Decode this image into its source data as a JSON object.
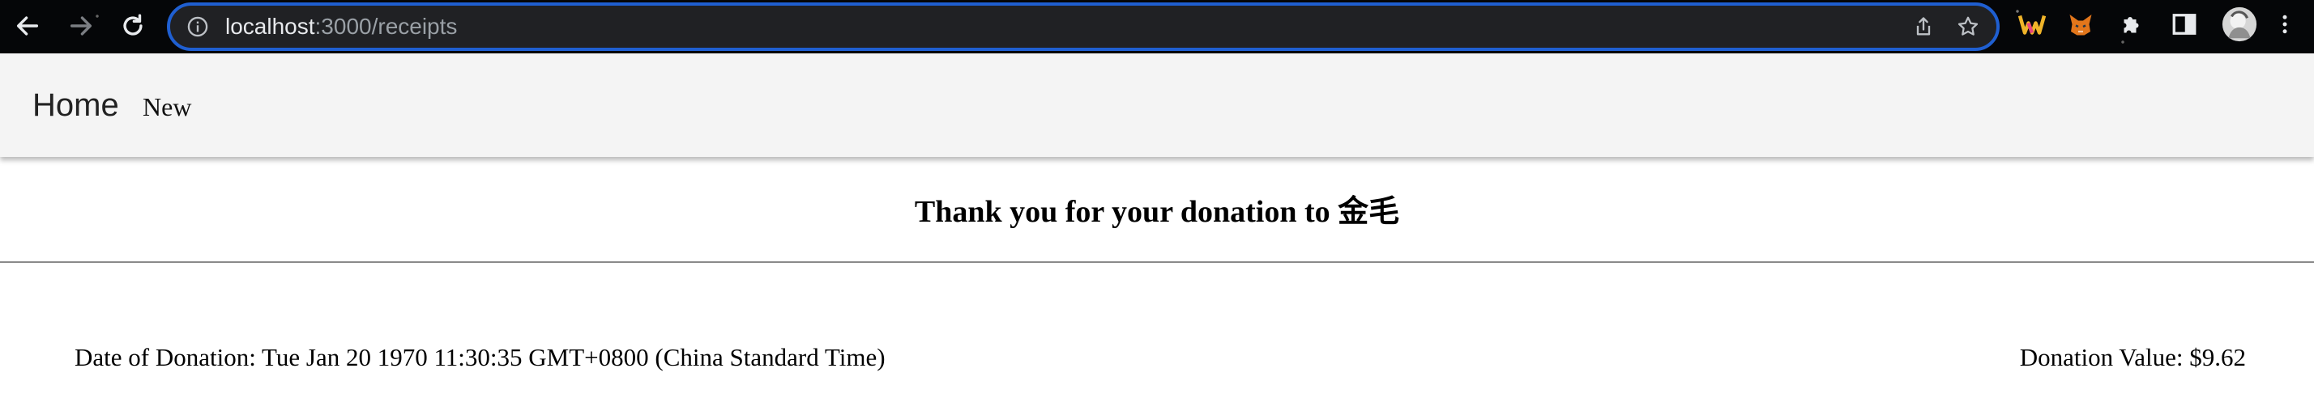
{
  "browser": {
    "url_host": "localhost",
    "url_path": ":3000/receipts",
    "accent_color": "#1f5fd1",
    "icons": [
      "back-arrow-icon",
      "forward-arrow-icon",
      "reload-icon",
      "info-icon",
      "share-icon",
      "star-icon",
      "extension-w-icon",
      "metamask-fox-icon",
      "puzzle-extensions-icon",
      "side-panel-icon",
      "profile-avatar-icon",
      "kebab-menu-icon"
    ]
  },
  "nav": {
    "brand": "Home",
    "new_link": "New"
  },
  "receipt": {
    "title": "Thank you for your donation to 金毛",
    "date_label": "Date of Donation:",
    "date_value": "Tue Jan 20 1970 11:30:35 GMT+0800 (China Standard Time)",
    "value_label": "Donation Value:",
    "value_amount": "$9.62"
  }
}
